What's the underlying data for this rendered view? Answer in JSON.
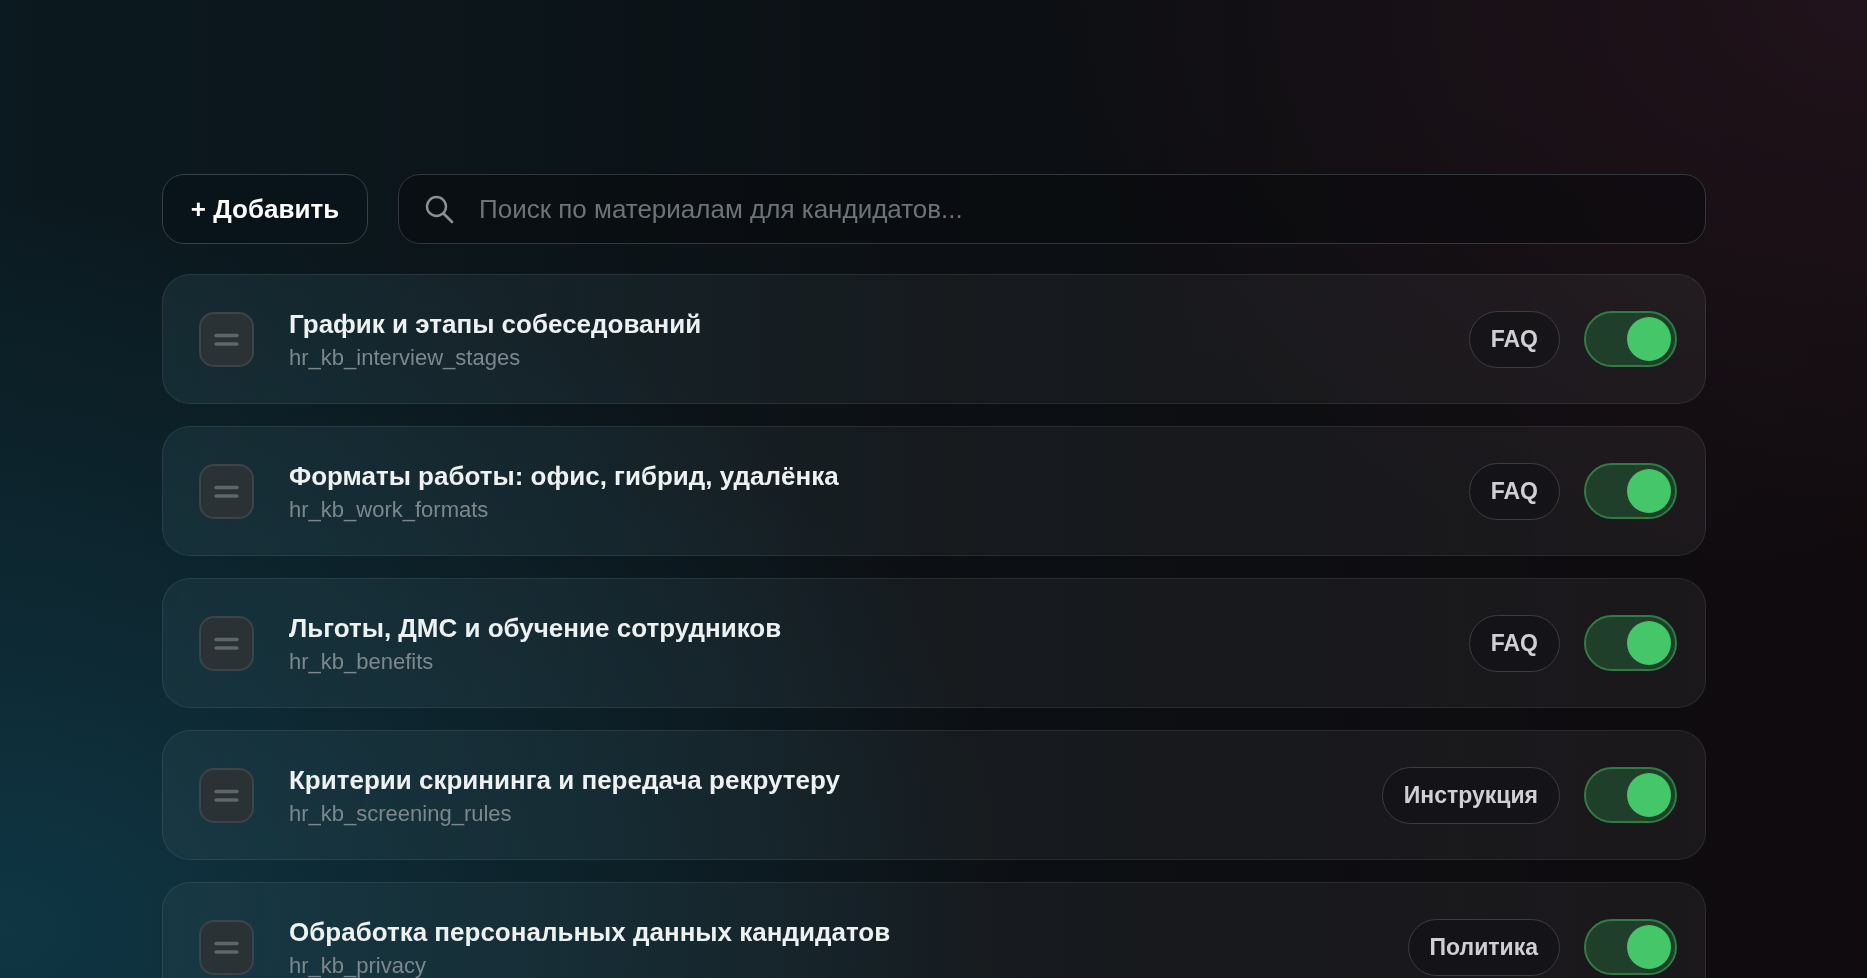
{
  "toolbar": {
    "add_button": {
      "label": "+ Добавить"
    },
    "search": {
      "placeholder": "Поиск по материалам для кандидатов..."
    }
  },
  "items": [
    {
      "title": "График и этапы собеседований",
      "key": "hr_kb_interview_stages",
      "tag": "FAQ",
      "on": true
    },
    {
      "title": "Форматы работы: офис, гибрид, удалёнка",
      "key": "hr_kb_work_formats",
      "tag": "FAQ",
      "on": true
    },
    {
      "title": "Льготы, ДМС и обучение сотрудников",
      "key": "hr_kb_benefits",
      "tag": "FAQ",
      "on": true
    },
    {
      "title": "Критерии скрининга и передача рекрутеру",
      "key": "hr_kb_screening_rules",
      "tag": "Инструкция",
      "on": true
    },
    {
      "title": "Обработка персональных данных кандидатов",
      "key": "hr_kb_privacy",
      "tag": "Политика",
      "on": true
    }
  ]
}
